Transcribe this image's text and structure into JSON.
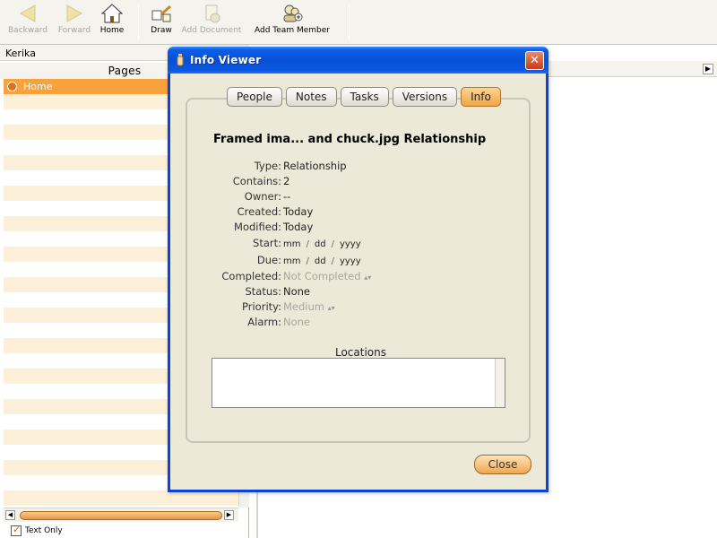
{
  "toolbar": {
    "backward": "Backward",
    "forward": "Forward",
    "home": "Home",
    "draw": "Draw",
    "add_document": "Add Document",
    "add_team_member": "Add Team Member"
  },
  "left": {
    "header": "Kerika",
    "pages_label": "Pages",
    "items": [
      "Home"
    ],
    "text_only": "Text Only"
  },
  "dialog": {
    "title": "Info Viewer",
    "close_symbol": "✕",
    "tabs": [
      "People",
      "Notes",
      "Tasks",
      "Versions",
      "Info"
    ],
    "active_tab": "Info",
    "heading": "Framed ima... and chuck.jpg Relationship",
    "props": {
      "type": {
        "label": "Type:",
        "value": "Relationship"
      },
      "contains": {
        "label": "Contains:",
        "value": "2"
      },
      "owner": {
        "label": "Owner:",
        "value": "--"
      },
      "created": {
        "label": "Created:",
        "value": "Today"
      },
      "modified": {
        "label": "Modified:",
        "value": "Today"
      },
      "start": {
        "label": "Start:",
        "mm": "mm",
        "dd": "dd",
        "yyyy": "yyyy"
      },
      "due": {
        "label": "Due:",
        "mm": "mm",
        "dd": "dd",
        "yyyy": "yyyy"
      },
      "completed": {
        "label": "Completed:",
        "value": "Not Completed"
      },
      "status": {
        "label": "Status:",
        "value": "None"
      },
      "priority": {
        "label": "Priority:",
        "value": "Medium"
      },
      "alarm": {
        "label": "Alarm:",
        "value": "None"
      }
    },
    "locations_label": "Locations",
    "close_button": "Close"
  },
  "colors": {
    "titlebar": "#0850d4",
    "accent_orange": "#f2a447",
    "dialog_bg": "#ece9d8"
  }
}
